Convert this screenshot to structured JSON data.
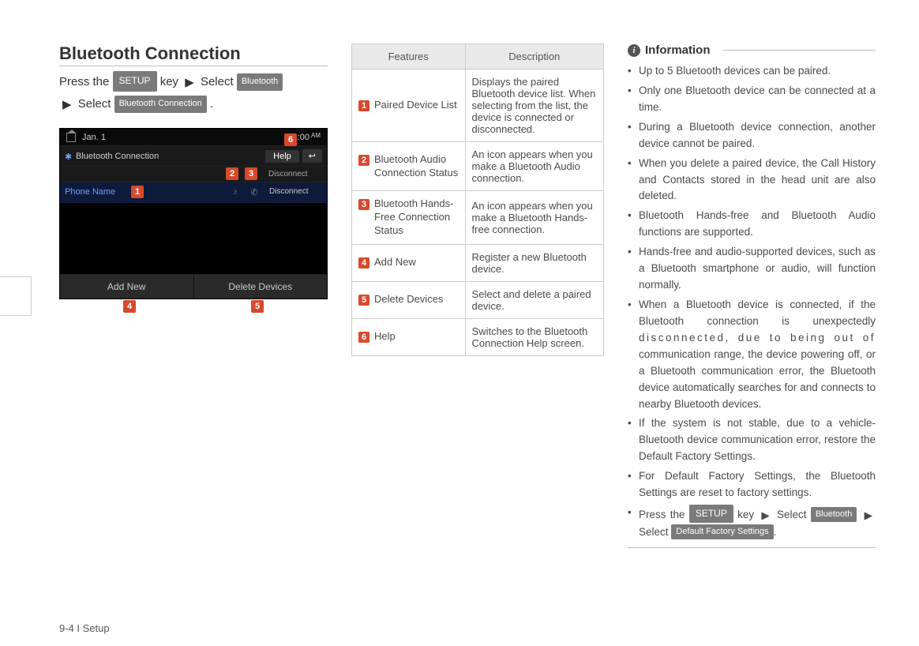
{
  "section_title": "Bluetooth Connection",
  "instruction": {
    "prefix": "Press the ",
    "setup_btn": "SETUP",
    "mid1": " key ",
    "arrow": "▶",
    "select1": " Select ",
    "bluetooth_btn": "Bluetooth",
    "select2": " Select ",
    "conn_btn": "Bluetooth Connection",
    "period": "."
  },
  "screenshot": {
    "date": "Jan. 1",
    "time": "12:00",
    "ampm": "AM",
    "title": "Bluetooth Connection",
    "help": "Help",
    "back": "↩",
    "header_disconnect": "Disconnect",
    "device_name": "Phone Name",
    "disconnect": "Disconnect",
    "add_new": "Add New",
    "delete_devices": "Delete Devices",
    "callouts": {
      "c1": "1",
      "c2": "2",
      "c3": "3",
      "c4": "4",
      "c5": "5",
      "c6": "6"
    }
  },
  "table": {
    "h_features": "Features",
    "h_description": "Description",
    "rows": [
      {
        "n": "1",
        "label": "Paired Device List",
        "desc": "Displays the paired Bluetooth device list. When selecting from the list, the device is connected or disconnected."
      },
      {
        "n": "2",
        "label": "Bluetooth Audio Connection Status",
        "desc": "An icon appears when you make a Bluetooth Audio connection."
      },
      {
        "n": "3",
        "label": "Bluetooth Hands-Free Connection Status",
        "desc": "An icon appears when you make a Bluetooth Hands-free connection."
      },
      {
        "n": "4",
        "label": "Add New",
        "desc": "Register a new Bluetooth device."
      },
      {
        "n": "5",
        "label": "Delete Devices",
        "desc": "Select and delete a paired device."
      },
      {
        "n": "6",
        "label": "Help",
        "desc": "Switches to the Bluetooth Connection Help screen."
      }
    ]
  },
  "info": {
    "heading": "Information",
    "items": [
      "Up to 5 Bluetooth devices can be paired.",
      "Only one Bluetooth device can be connected at a time.",
      "During a Bluetooth device connection, another device cannot be paired.",
      "When you delete a paired device, the Call History and Contacts stored in the head unit are also deleted.",
      "Bluetooth Hands-free and Bluetooth Audio functions are supported.",
      "Hands-free and audio-supported devices, such as a Bluetooth smartphone or audio, will function normally."
    ],
    "item_long_a": "When a Bluetooth device is connected, if the Bluetooth connection is unexpectedly ",
    "item_long_spaced": "disconnected, due to being out of",
    "item_long_b": " communication range, the device powering off, or a Bluetooth communication error, the Bluetooth device automatically searches for and connects to nearby Bluetooth devices.",
    "items2": [
      "If the system is not stable, due to a vehicle-Bluetooth device communication error, restore the Default Factory Settings.",
      "For Default Factory Settings, the Bluetooth Settings are reset to factory settings."
    ],
    "last": {
      "prefix": "Press the ",
      "setup": "SETUP",
      "mid": " key ",
      "arrow": "▶",
      "sel1": " Select ",
      "bluetooth": "Bluetooth",
      "sel2": " Select ",
      "dfs": "Default Factory Settings",
      "period": "."
    }
  },
  "footer": "9-4 I Setup"
}
